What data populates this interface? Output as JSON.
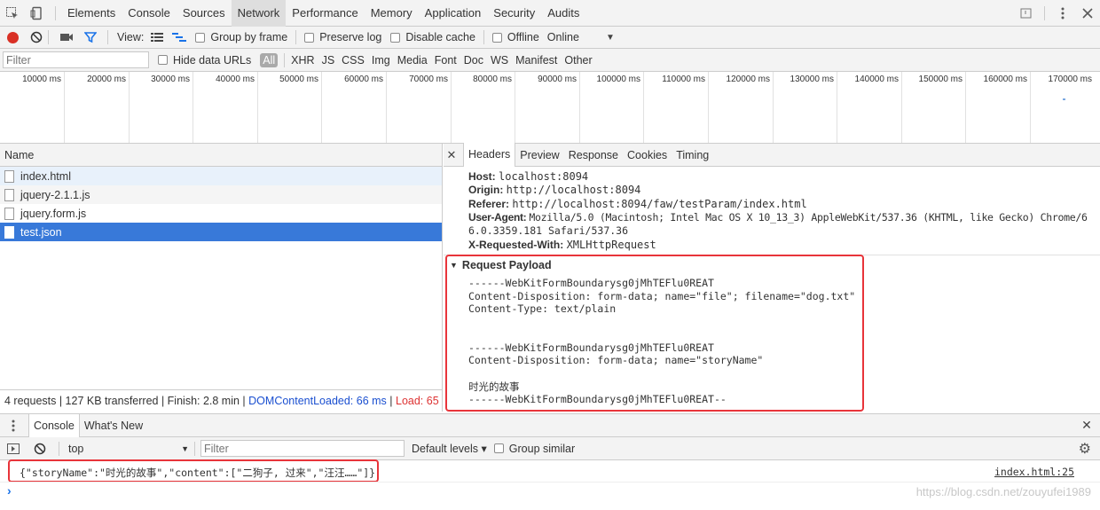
{
  "topbar": {
    "tabs": [
      "Elements",
      "Console",
      "Sources",
      "Network",
      "Performance",
      "Memory",
      "Application",
      "Security",
      "Audits"
    ],
    "selected": "Network",
    "icons": [
      "inspect-icon",
      "device-toolbar-icon",
      "warning-icon",
      "more-icon",
      "close-icon"
    ]
  },
  "toolbar": {
    "view_label": "View:",
    "group_by_frame": "Group by frame",
    "preserve_log": "Preserve log",
    "disable_cache": "Disable cache",
    "offline": "Offline",
    "throttle": "Online"
  },
  "filterbar": {
    "placeholder": "Filter",
    "hide_data_urls": "Hide data URLs",
    "types": [
      "All",
      "XHR",
      "JS",
      "CSS",
      "Img",
      "Media",
      "Font",
      "Doc",
      "WS",
      "Manifest",
      "Other"
    ]
  },
  "overview": {
    "ticks": [
      "10000 ms",
      "20000 ms",
      "30000 ms",
      "40000 ms",
      "50000 ms",
      "60000 ms",
      "70000 ms",
      "80000 ms",
      "90000 ms",
      "100000 ms",
      "110000 ms",
      "120000 ms",
      "130000 ms",
      "140000 ms",
      "150000 ms",
      "160000 ms",
      "170000 ms"
    ]
  },
  "list": {
    "header": "Name",
    "requests": [
      "index.html",
      "jquery-2.1.1.js",
      "jquery.form.js",
      "test.json"
    ],
    "summary": {
      "main": "4 requests | 127 KB transferred | Finish: 2.8 min | ",
      "dcl": "DOMContentLoaded: 66 ms",
      "sep": " | ",
      "load": "Load: 65 …"
    }
  },
  "details": {
    "tabs": [
      "Headers",
      "Preview",
      "Response",
      "Cookies",
      "Timing"
    ],
    "selected": "Headers",
    "headers": [
      {
        "key": "Host:",
        "value": "localhost:8094"
      },
      {
        "key": "Origin:",
        "value": "http://localhost:8094"
      },
      {
        "key": "Referer:",
        "value": "http://localhost:8094/faw/testParam/index.html"
      },
      {
        "key": "User-Agent:",
        "value": "Mozilla/5.0 (Macintosh; Intel Mac OS X 10_13_3) AppleWebKit/537.36 (KHTML, like Gecko) Chrome/6"
      },
      {
        "key": "",
        "value": "6.0.3359.181 Safari/537.36"
      },
      {
        "key": "X-Requested-With:",
        "value": "XMLHttpRequest"
      }
    ],
    "payload_title": "Request Payload",
    "payload_lines": [
      "------WebKitFormBoundarysg0jMhTEFlu0REAT",
      "Content-Disposition: form-data; name=\"file\"; filename=\"dog.txt\"",
      "Content-Type: text/plain",
      "",
      "",
      "------WebKitFormBoundarysg0jMhTEFlu0REAT",
      "Content-Disposition: form-data; name=\"storyName\"",
      "",
      "时光的故事",
      "------WebKitFormBoundarysg0jMhTEFlu0REAT--"
    ]
  },
  "console": {
    "tabs": [
      "Console",
      "What's New"
    ],
    "context": "top",
    "filter_placeholder": "Filter",
    "levels": "Default levels ▾",
    "group_similar": "Group similar",
    "message": "{\"storyName\":\"时光的故事\",\"content\":[\"二狗子, 过来\",\"汪汪……\"]}",
    "source": "index.html:25",
    "prompt": "›"
  },
  "watermark": "https://blog.csdn.net/zouyufei1989",
  "colors": {
    "accent": "#1a73e8",
    "highlight": "#e8343a",
    "record": "#d93025",
    "selected_row": "#3879d9"
  }
}
